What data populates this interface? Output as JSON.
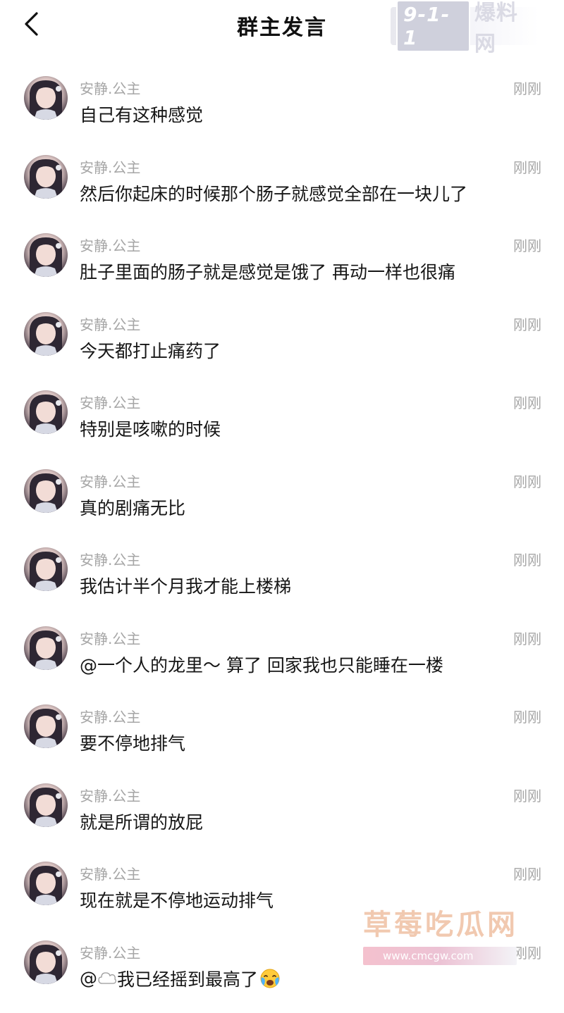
{
  "header": {
    "title": "群主发言",
    "back_icon": "chevron-left-icon"
  },
  "watermark_top": {
    "badge": "9-1-1",
    "text": "爆料网"
  },
  "watermark_bottom": {
    "title": "草莓吃瓜网",
    "url": "www.cmcgw.com"
  },
  "messages": [
    {
      "sender": "安静.公主",
      "time": "刚刚",
      "text": "自己有这种感觉"
    },
    {
      "sender": "安静.公主",
      "time": "刚刚",
      "text": "然后你起床的时候那个肠子就感觉全部在一块儿了"
    },
    {
      "sender": "安静.公主",
      "time": "刚刚",
      "text": "肚子里面的肠子就是感觉是饿了 再动一样也很痛"
    },
    {
      "sender": "安静.公主",
      "time": "刚刚",
      "text": "今天都打止痛药了"
    },
    {
      "sender": "安静.公主",
      "time": "刚刚",
      "text": "特别是咳嗽的时候"
    },
    {
      "sender": "安静.公主",
      "time": "刚刚",
      "text": "真的剧痛无比"
    },
    {
      "sender": "安静.公主",
      "time": "刚刚",
      "text": "我估计半个月我才能上楼梯"
    },
    {
      "sender": "安静.公主",
      "time": "刚刚",
      "text": "@一个人的龙里～ 算了 回家我也只能睡在一楼"
    },
    {
      "sender": "安静.公主",
      "time": "刚刚",
      "text": "要不停地排气"
    },
    {
      "sender": "安静.公主",
      "time": "刚刚",
      "text": "就是所谓的放屁"
    },
    {
      "sender": "安静.公主",
      "time": "刚刚",
      "text": "现在就是不停地运动排气"
    },
    {
      "sender": "安静.公主",
      "time": "刚刚",
      "text_prefix": "@",
      "text": " 我已经摇到最高了",
      "mention_icon": "cloud-icon",
      "emoji_icon": "crying-face-icon"
    }
  ]
}
